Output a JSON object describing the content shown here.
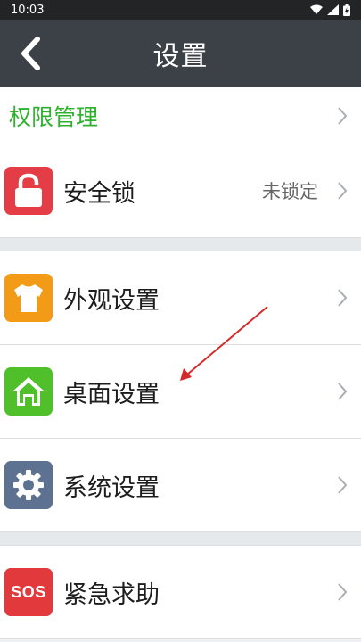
{
  "status_bar": {
    "time": "10:03"
  },
  "header": {
    "title": "设置"
  },
  "rows": {
    "permission": {
      "label": "权限管理"
    },
    "security_lock": {
      "label": "安全锁",
      "value": "未锁定"
    },
    "appearance": {
      "label": "外观设置"
    },
    "desktop": {
      "label": "桌面设置"
    },
    "system": {
      "label": "系统设置"
    },
    "emergency": {
      "label": "紧急求助",
      "icon_text": "SOS"
    }
  },
  "colors": {
    "permission_text": "#2fb12f",
    "lock_icon_bg": "#e43d45",
    "appearance_icon_bg": "#f39a16",
    "desktop_icon_bg": "#4fbf2a",
    "system_icon_bg": "#5d7291",
    "sos_icon_bg": "#e23a3c",
    "annotation_arrow": "#d42b2b"
  }
}
